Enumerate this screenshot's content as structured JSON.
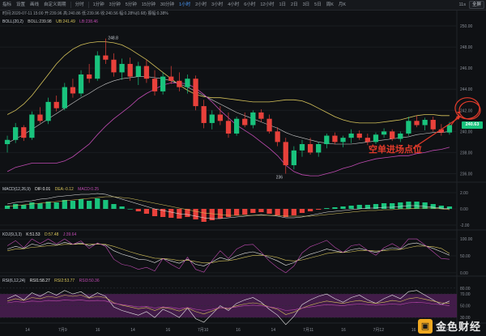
{
  "toolbar": {
    "items": [
      "指标",
      "设置",
      "画线",
      "自定义周期",
      "分时",
      "1分钟",
      "3分钟",
      "5分钟",
      "15分钟",
      "30分钟",
      "1小时",
      "2小时",
      "3小时",
      "4小时",
      "6小时",
      "12小时",
      "1日",
      "2日",
      "3日",
      "5日",
      "周K",
      "月K"
    ],
    "active_index": 10,
    "right_label": "11s",
    "right_button": "全屏"
  },
  "legends": {
    "ohlc": "时间:2020-07-11 15:00  开:239.96  高:240.86  低:239.96  收:240.56  幅:0.28%(0.68)  振幅:0.38%",
    "boll": [
      "BOLL(20,2)",
      "BOLL:239.98",
      "UB:241.49",
      "LB:238.46"
    ],
    "macd": [
      "MACD(12,26,9)",
      "DIF:0.01",
      "DEA:-0.12",
      "MACD:0.25"
    ],
    "kdj": [
      "KDJ(9,3,3)",
      "K:51.53",
      "D:57.48",
      "J:39.64"
    ],
    "rsi": [
      "RSI(6,12,24)",
      "RSI1:58.27",
      "RSI2:53.77",
      "RSI3:50.36"
    ]
  },
  "annotations": {
    "high_label": "248.8",
    "low_label": "236",
    "entry_text": "空单进场点位"
  },
  "price_badge": "240.63",
  "price_axis": [
    "250.00",
    "248.00",
    "246.00",
    "244.00",
    "242.00",
    "240.00",
    "238.00",
    "236.00"
  ],
  "macd_axis": [
    "2.00",
    "0.00",
    "-2.00"
  ],
  "kdj_axis": [
    "100.00",
    "50.00",
    "0.00"
  ],
  "rsi_axis": [
    "80.00",
    "70.00",
    "50.00",
    "30.00"
  ],
  "time_axis": [
    {
      "label": "14"
    },
    {
      "label": "7月9"
    },
    {
      "label": "16"
    },
    {
      "label": "14"
    },
    {
      "label": "16"
    },
    {
      "label": "7月10"
    },
    {
      "label": "16"
    },
    {
      "label": "14"
    },
    {
      "label": "7月11"
    },
    {
      "label": "16"
    },
    {
      "label": "7月12"
    },
    {
      "label": "16"
    },
    {
      "label": "7月13"
    }
  ],
  "watermark": {
    "logo": "▣",
    "text": "金色财经"
  },
  "colors": {
    "up": "#19c37d",
    "down": "#e8413b",
    "boll_upper": "#d6c35a",
    "boll_mid": "#c9c9c9",
    "boll_lower": "#c04bb2",
    "annotation": "#e23b2b",
    "rsi_band": "#4b1e52"
  },
  "chart_data": {
    "type": "candlestick",
    "ylim": [
      235.5,
      251
    ],
    "candles": [
      [
        238.8,
        239.6,
        238.0,
        239.2
      ],
      [
        239.2,
        240.8,
        238.9,
        240.4
      ],
      [
        240.4,
        240.6,
        239.1,
        239.4
      ],
      [
        239.4,
        241.9,
        239.2,
        241.6
      ],
      [
        241.6,
        242.3,
        240.8,
        241.0
      ],
      [
        241.0,
        243.2,
        240.7,
        242.8
      ],
      [
        242.8,
        243.4,
        241.9,
        242.2
      ],
      [
        242.2,
        244.6,
        242.0,
        244.2
      ],
      [
        244.2,
        245.0,
        243.2,
        243.6
      ],
      [
        243.6,
        245.8,
        243.3,
        245.4
      ],
      [
        245.4,
        246.4,
        244.6,
        245.0
      ],
      [
        245.0,
        247.6,
        244.8,
        247.2
      ],
      [
        247.2,
        248.8,
        246.4,
        246.8
      ],
      [
        246.8,
        247.4,
        245.2,
        245.6
      ],
      [
        245.6,
        246.9,
        244.9,
        246.4
      ],
      [
        246.4,
        247.0,
        244.8,
        245.2
      ],
      [
        245.2,
        246.6,
        244.4,
        246.2
      ],
      [
        246.2,
        246.8,
        244.6,
        245.0
      ],
      [
        245.0,
        245.8,
        243.4,
        243.8
      ],
      [
        243.8,
        245.6,
        243.5,
        245.2
      ],
      [
        245.2,
        246.2,
        244.5,
        244.8
      ],
      [
        244.8,
        245.6,
        243.8,
        244.2
      ],
      [
        244.2,
        245.4,
        243.6,
        245.0
      ],
      [
        245.0,
        245.3,
        242.0,
        242.4
      ],
      [
        242.4,
        243.0,
        240.3,
        240.8
      ],
      [
        240.8,
        242.0,
        240.2,
        241.6
      ],
      [
        241.6,
        242.4,
        240.6,
        241.0
      ],
      [
        241.0,
        241.8,
        239.4,
        239.8
      ],
      [
        239.8,
        241.4,
        239.6,
        241.2
      ],
      [
        241.2,
        241.8,
        240.4,
        240.6
      ],
      [
        240.6,
        242.0,
        240.3,
        241.8
      ],
      [
        241.8,
        242.1,
        240.9,
        241.2
      ],
      [
        241.2,
        241.6,
        239.8,
        240.0
      ],
      [
        240.0,
        240.4,
        238.6,
        239.0
      ],
      [
        239.0,
        239.4,
        236.0,
        236.8
      ],
      [
        236.8,
        238.6,
        236.4,
        238.2
      ],
      [
        238.2,
        239.2,
        237.6,
        238.8
      ],
      [
        238.8,
        239.4,
        237.8,
        238.0
      ],
      [
        238.0,
        239.0,
        237.6,
        238.8
      ],
      [
        238.8,
        239.8,
        238.4,
        239.6
      ],
      [
        239.6,
        239.9,
        238.8,
        239.0
      ],
      [
        239.0,
        239.6,
        238.5,
        239.4
      ],
      [
        239.4,
        240.2,
        238.9,
        239.8
      ],
      [
        239.8,
        240.1,
        239.2,
        239.4
      ],
      [
        239.4,
        239.8,
        238.7,
        239.0
      ],
      [
        239.0,
        239.9,
        238.8,
        239.7
      ],
      [
        239.7,
        240.3,
        239.4,
        240.0
      ],
      [
        240.0,
        240.2,
        239.1,
        239.3
      ],
      [
        239.3,
        240.0,
        239.0,
        239.8
      ],
      [
        239.8,
        241.4,
        239.6,
        241.0
      ],
      [
        241.0,
        241.5,
        240.4,
        240.6
      ],
      [
        240.6,
        241.3,
        240.1,
        241.1
      ],
      [
        241.1,
        241.4,
        240.0,
        240.2
      ],
      [
        240.2,
        240.7,
        239.6,
        239.9
      ],
      [
        239.9,
        240.9,
        239.7,
        240.6
      ]
    ],
    "boll_upper": [
      241.6,
      242.0,
      242.6,
      243.4,
      244.4,
      245.4,
      246.4,
      247.2,
      247.8,
      248.2,
      248.4,
      248.5,
      248.5,
      248.4,
      248.2,
      247.8,
      247.3,
      246.8,
      246.2,
      245.6,
      245.0,
      244.4,
      243.9,
      243.5,
      243.3,
      243.2,
      243.2,
      243.1,
      243.0,
      242.9,
      242.8,
      242.8,
      242.8,
      242.9,
      243.0,
      243.0,
      242.9,
      242.6,
      242.2,
      241.8,
      241.4,
      241.1,
      240.9,
      240.8,
      240.8,
      240.8,
      240.9,
      241.0,
      241.1,
      241.3,
      241.5,
      241.6,
      241.6,
      241.5,
      241.5
    ],
    "boll_mid": [
      238.9,
      239.3,
      239.7,
      240.2,
      240.7,
      241.2,
      241.7,
      242.2,
      242.7,
      243.2,
      243.6,
      244.1,
      244.5,
      244.8,
      245.0,
      245.1,
      245.2,
      245.2,
      245.1,
      245.0,
      244.8,
      244.5,
      244.2,
      243.8,
      243.4,
      243.0,
      242.6,
      242.2,
      241.8,
      241.5,
      241.2,
      240.9,
      240.6,
      240.3,
      239.9,
      239.6,
      239.4,
      239.2,
      239.0,
      238.9,
      238.8,
      238.8,
      238.8,
      238.9,
      239.0,
      239.1,
      239.2,
      239.3,
      239.4,
      239.5,
      239.7,
      239.8,
      239.9,
      239.9,
      240.0
    ],
    "boll_lower": [
      236.2,
      236.6,
      236.8,
      237.0,
      237.0,
      237.0,
      237.0,
      237.2,
      237.6,
      238.2,
      238.8,
      239.7,
      240.5,
      241.2,
      241.8,
      242.4,
      243.1,
      243.6,
      244.0,
      244.4,
      244.6,
      244.6,
      244.5,
      244.1,
      243.5,
      242.8,
      242.0,
      241.3,
      240.6,
      240.1,
      239.6,
      239.0,
      238.4,
      237.7,
      236.8,
      236.2,
      235.9,
      235.8,
      235.8,
      236.0,
      236.2,
      236.5,
      236.7,
      237.0,
      237.2,
      237.4,
      237.5,
      237.6,
      237.7,
      237.7,
      237.9,
      238.0,
      238.2,
      238.3,
      238.5
    ],
    "macd_hist": [
      0.4,
      0.6,
      0.5,
      0.8,
      0.7,
      0.9,
      0.8,
      1.1,
      1.0,
      1.2,
      1.0,
      1.3,
      1.1,
      0.6,
      0.3,
      0.0,
      -0.3,
      -0.6,
      -0.9,
      -1.0,
      -1.1,
      -1.2,
      -1.0,
      -1.3,
      -1.6,
      -1.4,
      -1.2,
      -1.0,
      -0.8,
      -0.7,
      -0.5,
      -0.4,
      -0.6,
      -0.8,
      -1.0,
      -0.8,
      -0.5,
      -0.3,
      -0.1,
      0.1,
      0.2,
      0.3,
      0.4,
      0.5,
      0.5,
      0.6,
      0.7,
      0.7,
      0.8,
      0.9,
      0.9,
      0.8,
      0.6,
      0.4,
      0.3
    ],
    "macd_dif": [
      0.6,
      0.8,
      0.9,
      1.0,
      1.2,
      1.3,
      1.5,
      1.6,
      1.7,
      1.8,
      1.8,
      1.9,
      1.8,
      1.5,
      1.2,
      0.9,
      0.6,
      0.3,
      0.0,
      -0.2,
      -0.4,
      -0.6,
      -0.7,
      -0.9,
      -1.1,
      -1.2,
      -1.2,
      -1.1,
      -1.0,
      -0.9,
      -0.8,
      -0.7,
      -0.8,
      -0.9,
      -1.1,
      -1.1,
      -1.0,
      -0.8,
      -0.6,
      -0.4,
      -0.3,
      -0.2,
      -0.1,
      0.0,
      0.1,
      0.1,
      0.2,
      0.2,
      0.3,
      0.4,
      0.4,
      0.3,
      0.2,
      0.1,
      0.0
    ],
    "macd_dea": [
      0.3,
      0.4,
      0.5,
      0.6,
      0.7,
      0.8,
      0.9,
      1.0,
      1.1,
      1.2,
      1.3,
      1.4,
      1.5,
      1.5,
      1.4,
      1.3,
      1.1,
      0.9,
      0.7,
      0.5,
      0.3,
      0.1,
      -0.1,
      -0.3,
      -0.5,
      -0.6,
      -0.7,
      -0.8,
      -0.8,
      -0.8,
      -0.8,
      -0.8,
      -0.8,
      -0.8,
      -0.9,
      -0.9,
      -0.9,
      -0.9,
      -0.8,
      -0.7,
      -0.6,
      -0.5,
      -0.4,
      -0.3,
      -0.2,
      -0.2,
      -0.1,
      -0.1,
      0.0,
      0.0,
      0.1,
      0.1,
      0.1,
      0.0,
      -0.1
    ],
    "kdj_k": [
      70,
      78,
      72,
      85,
      80,
      88,
      82,
      90,
      84,
      88,
      80,
      86,
      82,
      65,
      55,
      48,
      40,
      38,
      30,
      42,
      35,
      28,
      40,
      25,
      20,
      32,
      45,
      38,
      50,
      58,
      62,
      55,
      45,
      35,
      22,
      30,
      45,
      55,
      62,
      70,
      65,
      60,
      68,
      72,
      66,
      60,
      68,
      74,
      70,
      85,
      88,
      80,
      72,
      62,
      52
    ],
    "kdj_d": [
      65,
      70,
      71,
      75,
      77,
      80,
      81,
      84,
      84,
      85,
      84,
      85,
      84,
      78,
      70,
      62,
      55,
      49,
      43,
      42,
      40,
      36,
      37,
      33,
      29,
      30,
      35,
      36,
      40,
      46,
      51,
      52,
      50,
      45,
      37,
      35,
      38,
      44,
      50,
      57,
      60,
      60,
      62,
      66,
      66,
      64,
      65,
      68,
      69,
      74,
      79,
      79,
      77,
      72,
      57
    ],
    "kdj_j": [
      80,
      95,
      74,
      100,
      86,
      100,
      85,
      100,
      84,
      94,
      72,
      88,
      78,
      40,
      25,
      20,
      10,
      16,
      5,
      42,
      25,
      12,
      46,
      10,
      2,
      36,
      65,
      42,
      70,
      82,
      84,
      61,
      35,
      15,
      0,
      20,
      59,
      77,
      86,
      96,
      75,
      60,
      80,
      84,
      66,
      52,
      74,
      86,
      72,
      100,
      100,
      82,
      62,
      42,
      40
    ],
    "rsi1": [
      62,
      68,
      60,
      72,
      66,
      74,
      68,
      76,
      70,
      74,
      64,
      72,
      66,
      48,
      42,
      38,
      34,
      40,
      30,
      44,
      38,
      30,
      46,
      28,
      22,
      36,
      50,
      42,
      54,
      60,
      64,
      56,
      44,
      34,
      18,
      32,
      52,
      60,
      66,
      70,
      62,
      56,
      64,
      68,
      60,
      54,
      62,
      68,
      62,
      74,
      76,
      68,
      60,
      52,
      58
    ],
    "rsi2": [
      58,
      62,
      59,
      64,
      62,
      66,
      64,
      68,
      66,
      68,
      63,
      66,
      64,
      55,
      51,
      48,
      45,
      47,
      42,
      47,
      45,
      41,
      46,
      40,
      36,
      41,
      47,
      45,
      50,
      53,
      55,
      53,
      48,
      44,
      35,
      39,
      46,
      51,
      55,
      58,
      56,
      54,
      57,
      59,
      56,
      54,
      56,
      59,
      57,
      62,
      64,
      61,
      58,
      55,
      54
    ],
    "rsi3": [
      55,
      57,
      56,
      58,
      57,
      59,
      58,
      60,
      59,
      60,
      58,
      59,
      58,
      54,
      52,
      50,
      48,
      49,
      46,
      48,
      47,
      45,
      47,
      44,
      42,
      44,
      47,
      46,
      48,
      50,
      51,
      50,
      48,
      46,
      42,
      43,
      46,
      48,
      50,
      52,
      51,
      50,
      52,
      53,
      52,
      51,
      52,
      53,
      52,
      55,
      56,
      55,
      53,
      52,
      50
    ]
  }
}
